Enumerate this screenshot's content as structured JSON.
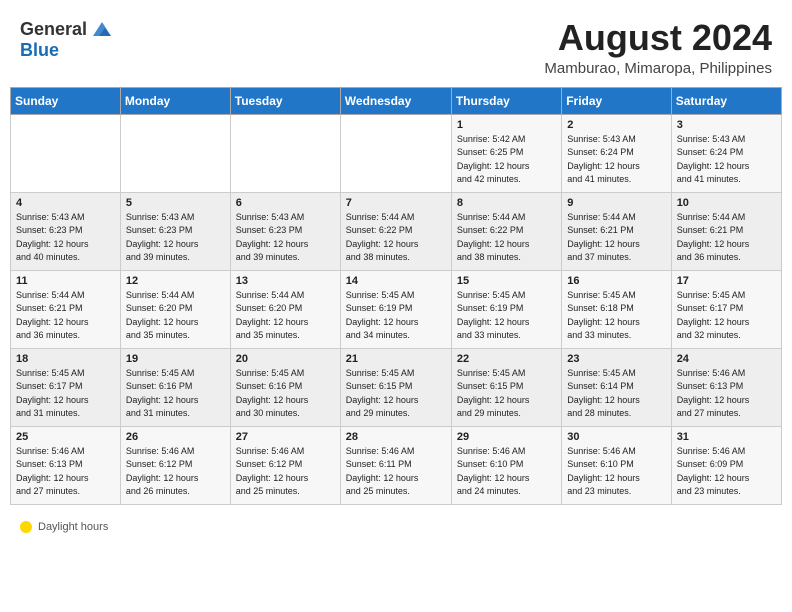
{
  "header": {
    "logo_general": "General",
    "logo_blue": "Blue",
    "month_title": "August 2024",
    "location": "Mamburao, Mimaropa, Philippines"
  },
  "weekdays": [
    "Sunday",
    "Monday",
    "Tuesday",
    "Wednesday",
    "Thursday",
    "Friday",
    "Saturday"
  ],
  "weeks": [
    [
      {
        "day": "",
        "info": ""
      },
      {
        "day": "",
        "info": ""
      },
      {
        "day": "",
        "info": ""
      },
      {
        "day": "",
        "info": ""
      },
      {
        "day": "1",
        "info": "Sunrise: 5:42 AM\nSunset: 6:25 PM\nDaylight: 12 hours\nand 42 minutes."
      },
      {
        "day": "2",
        "info": "Sunrise: 5:43 AM\nSunset: 6:24 PM\nDaylight: 12 hours\nand 41 minutes."
      },
      {
        "day": "3",
        "info": "Sunrise: 5:43 AM\nSunset: 6:24 PM\nDaylight: 12 hours\nand 41 minutes."
      }
    ],
    [
      {
        "day": "4",
        "info": "Sunrise: 5:43 AM\nSunset: 6:23 PM\nDaylight: 12 hours\nand 40 minutes."
      },
      {
        "day": "5",
        "info": "Sunrise: 5:43 AM\nSunset: 6:23 PM\nDaylight: 12 hours\nand 39 minutes."
      },
      {
        "day": "6",
        "info": "Sunrise: 5:43 AM\nSunset: 6:23 PM\nDaylight: 12 hours\nand 39 minutes."
      },
      {
        "day": "7",
        "info": "Sunrise: 5:44 AM\nSunset: 6:22 PM\nDaylight: 12 hours\nand 38 minutes."
      },
      {
        "day": "8",
        "info": "Sunrise: 5:44 AM\nSunset: 6:22 PM\nDaylight: 12 hours\nand 38 minutes."
      },
      {
        "day": "9",
        "info": "Sunrise: 5:44 AM\nSunset: 6:21 PM\nDaylight: 12 hours\nand 37 minutes."
      },
      {
        "day": "10",
        "info": "Sunrise: 5:44 AM\nSunset: 6:21 PM\nDaylight: 12 hours\nand 36 minutes."
      }
    ],
    [
      {
        "day": "11",
        "info": "Sunrise: 5:44 AM\nSunset: 6:21 PM\nDaylight: 12 hours\nand 36 minutes."
      },
      {
        "day": "12",
        "info": "Sunrise: 5:44 AM\nSunset: 6:20 PM\nDaylight: 12 hours\nand 35 minutes."
      },
      {
        "day": "13",
        "info": "Sunrise: 5:44 AM\nSunset: 6:20 PM\nDaylight: 12 hours\nand 35 minutes."
      },
      {
        "day": "14",
        "info": "Sunrise: 5:45 AM\nSunset: 6:19 PM\nDaylight: 12 hours\nand 34 minutes."
      },
      {
        "day": "15",
        "info": "Sunrise: 5:45 AM\nSunset: 6:19 PM\nDaylight: 12 hours\nand 33 minutes."
      },
      {
        "day": "16",
        "info": "Sunrise: 5:45 AM\nSunset: 6:18 PM\nDaylight: 12 hours\nand 33 minutes."
      },
      {
        "day": "17",
        "info": "Sunrise: 5:45 AM\nSunset: 6:17 PM\nDaylight: 12 hours\nand 32 minutes."
      }
    ],
    [
      {
        "day": "18",
        "info": "Sunrise: 5:45 AM\nSunset: 6:17 PM\nDaylight: 12 hours\nand 31 minutes."
      },
      {
        "day": "19",
        "info": "Sunrise: 5:45 AM\nSunset: 6:16 PM\nDaylight: 12 hours\nand 31 minutes."
      },
      {
        "day": "20",
        "info": "Sunrise: 5:45 AM\nSunset: 6:16 PM\nDaylight: 12 hours\nand 30 minutes."
      },
      {
        "day": "21",
        "info": "Sunrise: 5:45 AM\nSunset: 6:15 PM\nDaylight: 12 hours\nand 29 minutes."
      },
      {
        "day": "22",
        "info": "Sunrise: 5:45 AM\nSunset: 6:15 PM\nDaylight: 12 hours\nand 29 minutes."
      },
      {
        "day": "23",
        "info": "Sunrise: 5:45 AM\nSunset: 6:14 PM\nDaylight: 12 hours\nand 28 minutes."
      },
      {
        "day": "24",
        "info": "Sunrise: 5:46 AM\nSunset: 6:13 PM\nDaylight: 12 hours\nand 27 minutes."
      }
    ],
    [
      {
        "day": "25",
        "info": "Sunrise: 5:46 AM\nSunset: 6:13 PM\nDaylight: 12 hours\nand 27 minutes."
      },
      {
        "day": "26",
        "info": "Sunrise: 5:46 AM\nSunset: 6:12 PM\nDaylight: 12 hours\nand 26 minutes."
      },
      {
        "day": "27",
        "info": "Sunrise: 5:46 AM\nSunset: 6:12 PM\nDaylight: 12 hours\nand 25 minutes."
      },
      {
        "day": "28",
        "info": "Sunrise: 5:46 AM\nSunset: 6:11 PM\nDaylight: 12 hours\nand 25 minutes."
      },
      {
        "day": "29",
        "info": "Sunrise: 5:46 AM\nSunset: 6:10 PM\nDaylight: 12 hours\nand 24 minutes."
      },
      {
        "day": "30",
        "info": "Sunrise: 5:46 AM\nSunset: 6:10 PM\nDaylight: 12 hours\nand 23 minutes."
      },
      {
        "day": "31",
        "info": "Sunrise: 5:46 AM\nSunset: 6:09 PM\nDaylight: 12 hours\nand 23 minutes."
      }
    ]
  ],
  "footer": {
    "daylight_label": "Daylight hours"
  }
}
